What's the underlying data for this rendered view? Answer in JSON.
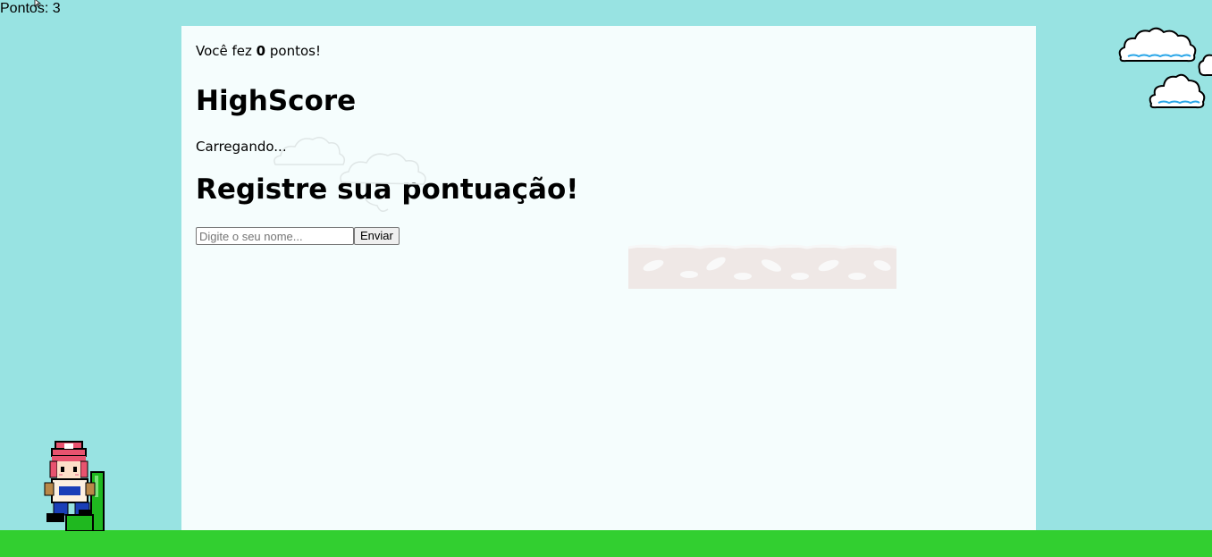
{
  "hud": {
    "score_label": "Pontos: 3"
  },
  "panel": {
    "score_prefix": "Você fez ",
    "score_value": "0",
    "score_suffix": " pontos!",
    "highscore_title": "HighScore",
    "loading_text": "Carregando...",
    "register_title": "Registre sua pontuação!",
    "name_placeholder": "Digite o seu nome...",
    "send_label": "Enviar"
  },
  "colors": {
    "sky": "#98e3e2",
    "ground": "#32cf30",
    "panel_bg": "#f5fdfd"
  },
  "icons": {
    "player": "player-sprite-icon",
    "cloud": "cloud-icon",
    "cursor": "cursor-icon"
  }
}
